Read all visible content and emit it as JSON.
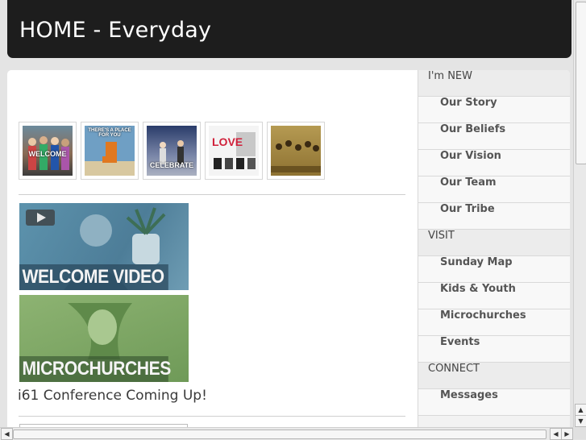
{
  "header": {
    "title": "HOME - Everyday"
  },
  "thumbnails": [
    {
      "name": "welcome-thumbnail",
      "caption": "WELCOME"
    },
    {
      "name": "place-for-you-thumbnail",
      "caption": "THERE'S A PLACE FOR YOU"
    },
    {
      "name": "celebrate-thumbnail",
      "caption": "CELEBRATE"
    },
    {
      "name": "love-thumbnail",
      "caption": "LOVE"
    },
    {
      "name": "community-thumbnail",
      "caption": ""
    }
  ],
  "promos": {
    "welcome_video": "WELCOME VIDEO",
    "microchurches": "MICROCHURCHES"
  },
  "news": {
    "headline": "i61 Conference Coming Up!"
  },
  "sidebar": {
    "items": [
      {
        "label": "I'm NEW",
        "type": "section"
      },
      {
        "label": "Our Story",
        "type": "child"
      },
      {
        "label": "Our Beliefs",
        "type": "child"
      },
      {
        "label": "Our Vision",
        "type": "child"
      },
      {
        "label": "Our Team",
        "type": "child"
      },
      {
        "label": "Our Tribe",
        "type": "child"
      },
      {
        "label": "VISIT",
        "type": "section"
      },
      {
        "label": "Sunday Map",
        "type": "child"
      },
      {
        "label": "Kids & Youth",
        "type": "child"
      },
      {
        "label": "Microchurches",
        "type": "child"
      },
      {
        "label": "Events",
        "type": "child"
      },
      {
        "label": "CONNECT",
        "type": "section"
      },
      {
        "label": "Messages",
        "type": "child"
      }
    ]
  }
}
